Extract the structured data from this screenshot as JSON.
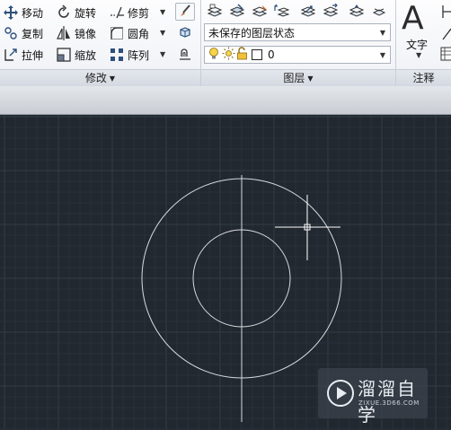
{
  "modify_panel": {
    "title": "修改",
    "tools": {
      "move": "移动",
      "rotate": "旋转",
      "trim": "修剪",
      "copy": "复制",
      "mirror": "镜像",
      "fillet": "圆角",
      "stretch": "拉伸",
      "scale": "缩放",
      "array": "阵列"
    }
  },
  "layers_panel": {
    "title": "图层",
    "layer_state": "未保存的图层状态",
    "current_layer": "0"
  },
  "annotation_panel": {
    "title": "注释",
    "text_label": "文字"
  },
  "watermark": {
    "title": "溜溜自学",
    "url": "ZIXUE.3D66.COM"
  },
  "colors": {
    "canvas_bg": "#212830",
    "grid_minor": "#2a313a",
    "grid_major": "#333b45",
    "geometry": "#d8dce0"
  }
}
